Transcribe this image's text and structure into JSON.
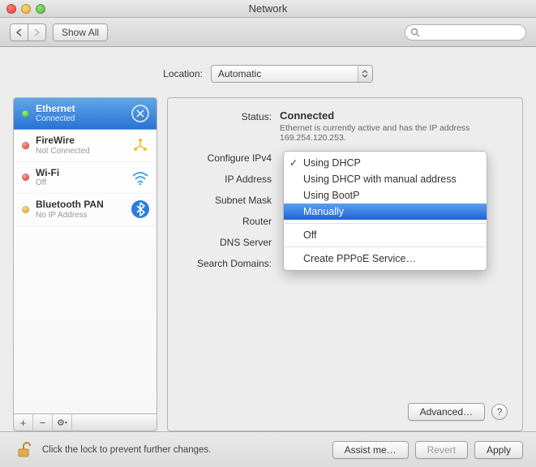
{
  "window": {
    "title": "Network"
  },
  "toolbar": {
    "show_all": "Show All",
    "search_placeholder": ""
  },
  "location": {
    "label": "Location:",
    "value": "Automatic"
  },
  "sidebar": {
    "items": [
      {
        "name": "Ethernet",
        "sub": "Connected",
        "status": "green",
        "icon": "ethernet",
        "selected": true
      },
      {
        "name": "FireWire",
        "sub": "Not Connected",
        "status": "red",
        "icon": "firewire",
        "selected": false
      },
      {
        "name": "Wi-Fi",
        "sub": "Off",
        "status": "red",
        "icon": "wifi",
        "selected": false
      },
      {
        "name": "Bluetooth PAN",
        "sub": "No IP Address",
        "status": "orange",
        "icon": "bluetooth",
        "selected": false
      }
    ]
  },
  "detail": {
    "labels": {
      "status": "Status:",
      "configure": "Configure IPv4",
      "ip": "IP Address",
      "subnet": "Subnet Mask",
      "router": "Router",
      "dns": "DNS Server",
      "search": "Search Domains:"
    },
    "status_value": "Connected",
    "status_desc": "Ethernet is currently active and has the IP address 169.254.120.253.",
    "advanced": "Advanced…"
  },
  "menu": {
    "checked": 0,
    "highlighted": 3,
    "items": [
      "Using DHCP",
      "Using DHCP with manual address",
      "Using BootP",
      "Manually",
      "Off",
      "Create PPPoE Service…"
    ]
  },
  "footer": {
    "lock_text": "Click the lock to prevent further changes.",
    "assist": "Assist me…",
    "revert": "Revert",
    "apply": "Apply"
  }
}
